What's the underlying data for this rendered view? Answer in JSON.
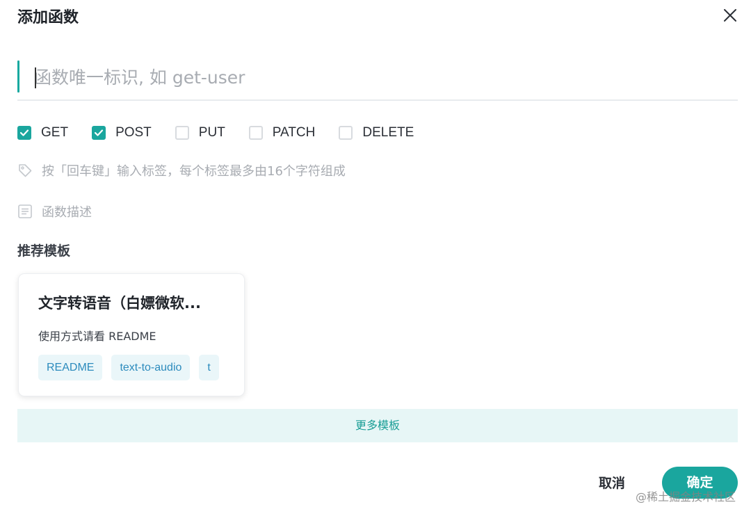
{
  "dialog": {
    "title": "添加函数"
  },
  "name_input": {
    "value": "",
    "placeholder": "函数唯一标识, 如 get-user"
  },
  "methods": [
    {
      "label": "GET",
      "checked": true
    },
    {
      "label": "POST",
      "checked": true
    },
    {
      "label": "PUT",
      "checked": false
    },
    {
      "label": "PATCH",
      "checked": false
    },
    {
      "label": "DELETE",
      "checked": false
    }
  ],
  "tags_hint": "按「回车键」输入标签，每个标签最多由16个字符组成",
  "description_hint": "函数描述",
  "templates": {
    "section_title": "推荐模板",
    "cards": [
      {
        "title": "文字转语音（白嫖微软...",
        "description": "使用方式请看 README",
        "tags": [
          "README",
          "text-to-audio",
          "t"
        ]
      }
    ],
    "more_label": "更多模板"
  },
  "footer": {
    "cancel_label": "取消",
    "confirm_label": "确定"
  },
  "watermark": "@稀土掘金技术社区",
  "colors": {
    "accent": "#1aa69e",
    "tag_bg": "#eaf6f9",
    "tag_text": "#2c8bbd",
    "more_bg": "#e7f6f6"
  },
  "icons": {
    "close": "close-icon",
    "tag": "tag-icon",
    "description": "document-icon",
    "check": "check-icon"
  }
}
